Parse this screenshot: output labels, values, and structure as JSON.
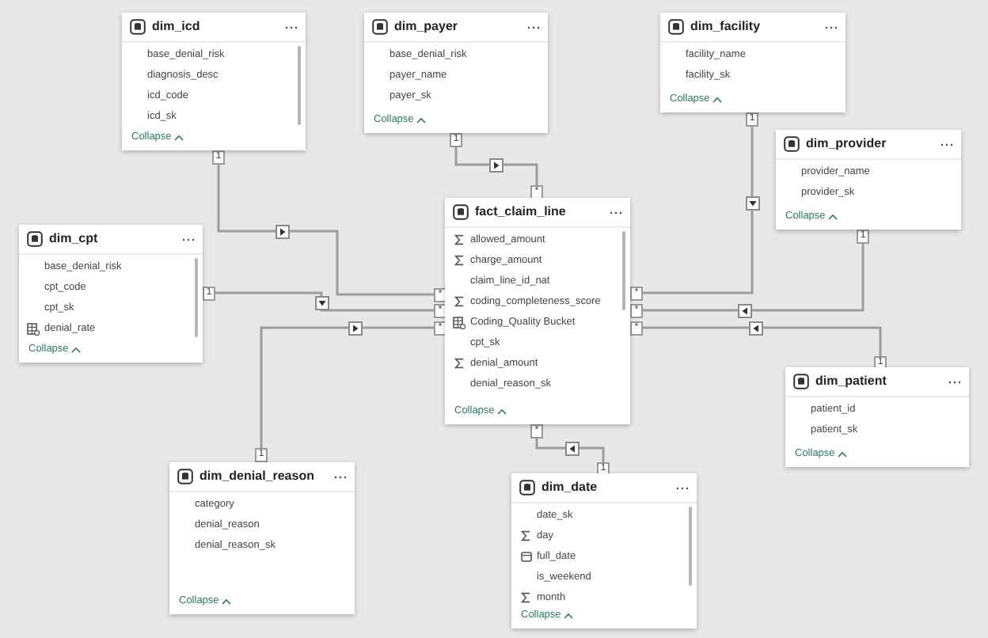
{
  "tables": [
    {
      "name": "dim_icd",
      "scrollable": true,
      "collapse_label": "Collapse",
      "fields": [
        {
          "name": "base_denial_risk",
          "kind": "plain"
        },
        {
          "name": "diagnosis_desc",
          "kind": "plain"
        },
        {
          "name": "icd_code",
          "kind": "plain"
        },
        {
          "name": "icd_sk",
          "kind": "plain"
        }
      ]
    },
    {
      "name": "dim_payer",
      "scrollable": false,
      "collapse_label": "Collapse",
      "fields": [
        {
          "name": "base_denial_risk",
          "kind": "plain"
        },
        {
          "name": "payer_name",
          "kind": "plain"
        },
        {
          "name": "payer_sk",
          "kind": "plain"
        }
      ]
    },
    {
      "name": "dim_facility",
      "scrollable": false,
      "collapse_label": "Collapse",
      "fields": [
        {
          "name": "facility_name",
          "kind": "plain"
        },
        {
          "name": "facility_sk",
          "kind": "plain"
        }
      ]
    },
    {
      "name": "dim_provider",
      "scrollable": false,
      "collapse_label": "Collapse",
      "fields": [
        {
          "name": "provider_name",
          "kind": "plain"
        },
        {
          "name": "provider_sk",
          "kind": "plain"
        }
      ]
    },
    {
      "name": "dim_cpt",
      "scrollable": true,
      "collapse_label": "Collapse",
      "fields": [
        {
          "name": "base_denial_risk",
          "kind": "plain"
        },
        {
          "name": "cpt_code",
          "kind": "plain"
        },
        {
          "name": "cpt_sk",
          "kind": "plain"
        },
        {
          "name": "denial_rate",
          "kind": "calculated"
        }
      ]
    },
    {
      "name": "fact_claim_line",
      "scrollable": true,
      "collapse_label": "Collapse",
      "fields": [
        {
          "name": "allowed_amount",
          "kind": "sum"
        },
        {
          "name": "charge_amount",
          "kind": "sum"
        },
        {
          "name": "claim_line_id_nat",
          "kind": "plain"
        },
        {
          "name": "coding_completeness_score",
          "kind": "sum"
        },
        {
          "name": "Coding_Quality Bucket",
          "kind": "calculated"
        },
        {
          "name": "cpt_sk",
          "kind": "plain"
        },
        {
          "name": "denial_amount",
          "kind": "sum"
        },
        {
          "name": "denial_reason_sk",
          "kind": "plain"
        }
      ]
    },
    {
      "name": "dim_patient",
      "scrollable": false,
      "collapse_label": "Collapse",
      "fields": [
        {
          "name": "patient_id",
          "kind": "plain"
        },
        {
          "name": "patient_sk",
          "kind": "plain"
        }
      ]
    },
    {
      "name": "dim_denial_reason",
      "scrollable": false,
      "collapse_label": "Collapse",
      "fields": [
        {
          "name": "category",
          "kind": "plain"
        },
        {
          "name": "denial_reason",
          "kind": "plain"
        },
        {
          "name": "denial_reason_sk",
          "kind": "plain"
        }
      ]
    },
    {
      "name": "dim_date",
      "scrollable": true,
      "collapse_label": "Collapse",
      "fields": [
        {
          "name": "date_sk",
          "kind": "plain"
        },
        {
          "name": "day",
          "kind": "sum"
        },
        {
          "name": "full_date",
          "kind": "date"
        },
        {
          "name": "is_weekend",
          "kind": "plain"
        },
        {
          "name": "month",
          "kind": "sum"
        }
      ]
    }
  ],
  "relationships": [
    {
      "one_label": "1",
      "many_label": "*",
      "kind": "right"
    },
    {
      "one_label": "1",
      "many_label": "*",
      "kind": "right"
    },
    {
      "one_label": "1",
      "many_label": "*",
      "kind": "down"
    },
    {
      "one_label": "1",
      "many_label": "*",
      "kind": "right"
    },
    {
      "one_label": "1",
      "many_label": "*",
      "kind": "down"
    },
    {
      "one_label": "1",
      "many_label": "*",
      "kind": "left"
    },
    {
      "one_label": "1",
      "many_label": "*",
      "kind": "left"
    },
    {
      "one_label": "1",
      "many_label": "*",
      "kind": "left"
    }
  ]
}
